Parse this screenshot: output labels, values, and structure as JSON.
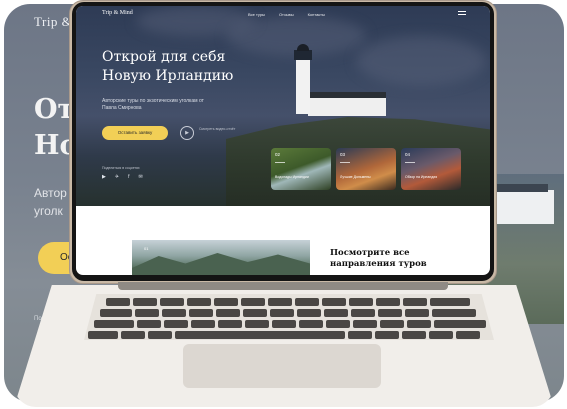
{
  "background": {
    "logo": "Trip & Mi",
    "hero_title_lines": [
      "От",
      "Но"
    ],
    "subtitle_lines": [
      "Автор",
      "уголк"
    ],
    "button_label": "Ос",
    "small_text": "Под"
  },
  "site": {
    "logo": "Trip & Mind",
    "nav": [
      "Все туры",
      "Отзывы",
      "Контакты"
    ],
    "hero": {
      "title": "Открой для себя Новую Ирландию",
      "subtitle": "Авторские туры по экзотическим уголкам от Павла Смирнова",
      "cta_label": "Оставить заявку",
      "play_label": "Смотреть видео-отчёт",
      "share_label": "Поделиться в соцсетях"
    },
    "socials": [
      "▶",
      "✈",
      "f",
      "✉"
    ],
    "cards": [
      {
        "num": "02",
        "caption": "Водопады Ирландии"
      },
      {
        "num": "03",
        "caption": "Лучшие Дольмены"
      },
      {
        "num": "04",
        "caption": "Обзор на Ирландия"
      }
    ],
    "content": {
      "image_num": "01",
      "title": "Посмотрите все направления туров"
    }
  },
  "colors": {
    "accent": "#f2cf56",
    "hero_dark": "#2e3b55",
    "laptop_frame": "#c9b9a6"
  }
}
